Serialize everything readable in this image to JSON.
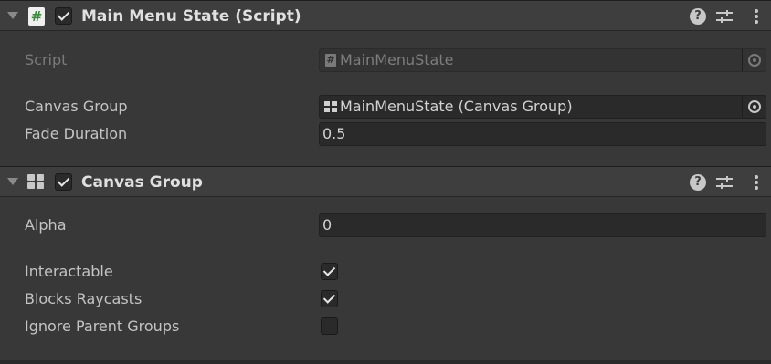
{
  "components": [
    {
      "title": "Main Menu State (Script)",
      "icon": "script-hash-icon",
      "enabled": true,
      "fields": {
        "script_label": "Script",
        "script_value": "MainMenuState",
        "canvas_group_label": "Canvas Group",
        "canvas_group_value": "MainMenuState (Canvas Group)",
        "fade_duration_label": "Fade Duration",
        "fade_duration_value": "0.5"
      }
    },
    {
      "title": "Canvas Group",
      "icon": "canvas-group-icon",
      "enabled": true,
      "fields": {
        "alpha_label": "Alpha",
        "alpha_value": "0",
        "interactable_label": "Interactable",
        "interactable_checked": true,
        "blocks_raycasts_label": "Blocks Raycasts",
        "blocks_raycasts_checked": true,
        "ignore_parent_groups_label": "Ignore Parent Groups",
        "ignore_parent_groups_checked": false
      }
    }
  ],
  "header_buttons": {
    "help_glyph": "?"
  },
  "colors": {
    "background": "#383838",
    "header": "#3e3e3e",
    "field": "#2a2a2a",
    "text": "#c4c4c4"
  }
}
